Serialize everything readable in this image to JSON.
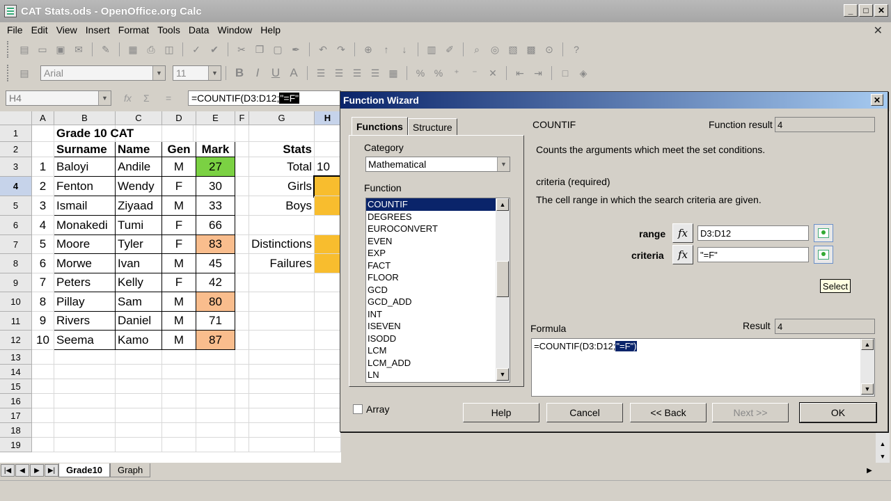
{
  "window": {
    "title": "CAT Stats.ods - OpenOffice.org Calc",
    "min": "_",
    "max": "□",
    "close": "✕",
    "doc_close": "✕"
  },
  "menu": [
    "File",
    "Edit",
    "View",
    "Insert",
    "Format",
    "Tools",
    "Data",
    "Window",
    "Help"
  ],
  "toolbar": {
    "font_name": "Arial",
    "font_size": "11"
  },
  "formula_bar": {
    "name_box": "H4",
    "formula_prefix": "=COUNTIF(D3:D12;",
    "formula_selected": "\"=F\""
  },
  "sheet": {
    "columns": [
      "A",
      "B",
      "C",
      "D",
      "E",
      "F",
      "G",
      "H"
    ],
    "rows": [
      "1",
      "2",
      "3",
      "4",
      "5",
      "6",
      "7",
      "8",
      "9",
      "10",
      "11",
      "12",
      "13",
      "14",
      "15",
      "16",
      "17",
      "18",
      "19"
    ],
    "title": "Grade 10 CAT",
    "headers": {
      "surname": "Surname",
      "name": "Name",
      "gen": "Gen",
      "mark": "Mark",
      "stats": "Stats"
    },
    "data": [
      {
        "num": "1",
        "surname": "Baloyi",
        "name": "Andile",
        "gen": "M",
        "mark": "27"
      },
      {
        "num": "2",
        "surname": "Fenton",
        "name": "Wendy",
        "gen": "F",
        "mark": "30"
      },
      {
        "num": "3",
        "surname": "Ismail",
        "name": "Ziyaad",
        "gen": "M",
        "mark": "33"
      },
      {
        "num": "4",
        "surname": "Monakedi",
        "name": "Tumi",
        "gen": "F",
        "mark": "66"
      },
      {
        "num": "5",
        "surname": "Moore",
        "name": "Tyler",
        "gen": "F",
        "mark": "83"
      },
      {
        "num": "6",
        "surname": "Morwe",
        "name": "Ivan",
        "gen": "M",
        "mark": "45"
      },
      {
        "num": "7",
        "surname": "Peters",
        "name": "Kelly",
        "gen": "F",
        "mark": "42"
      },
      {
        "num": "8",
        "surname": "Pillay",
        "name": "Sam",
        "gen": "M",
        "mark": "80"
      },
      {
        "num": "9",
        "surname": "Rivers",
        "name": "Daniel",
        "gen": "M",
        "mark": "71"
      },
      {
        "num": "10",
        "surname": "Seema",
        "name": "Kamo",
        "gen": "M",
        "mark": "87"
      }
    ],
    "stats": {
      "total_label": "Total",
      "total_value": "10",
      "girls": "Girls",
      "boys": "Boys",
      "distinctions": "Distinctions",
      "failures": "Failures"
    },
    "tabs": [
      "Grade10",
      "Graph"
    ]
  },
  "dialog": {
    "title": "Function Wizard",
    "tab_functions": "Functions",
    "tab_structure": "Structure",
    "category_label": "Category",
    "category_value": "Mathematical",
    "function_label": "Function",
    "functions": [
      "COUNTIF",
      "DEGREES",
      "EUROCONVERT",
      "EVEN",
      "EXP",
      "FACT",
      "FLOOR",
      "GCD",
      "GCD_ADD",
      "INT",
      "ISEVEN",
      "ISODD",
      "LCM",
      "LCM_ADD",
      "LN"
    ],
    "fn_name": "COUNTIF",
    "fn_result_label": "Function result",
    "fn_result_value": "4",
    "description": "Counts the arguments which meet the set conditions.",
    "arg_heading": "criteria (required)",
    "arg_description": "The cell range in which the search criteria are given.",
    "range_label": "range",
    "range_value": "D3:D12",
    "criteria_label": "criteria",
    "criteria_value": "\"=F\"",
    "fx": "fx",
    "tooltip": "Select",
    "formula_label": "Formula",
    "result_label": "Result",
    "result_value": "4",
    "formula_prefix": "=COUNTIF(D3:D12;",
    "formula_selected": "\"=F\")",
    "array_label": "Array",
    "buttons": {
      "help": "Help",
      "cancel": "Cancel",
      "back": "<< Back",
      "next": "Next >>",
      "ok": "OK"
    }
  },
  "colors": {
    "green": "#7bd143",
    "salmon": "#f9bd8d",
    "orange": "#f8bd2e",
    "dialog_title": "#0a246a"
  }
}
